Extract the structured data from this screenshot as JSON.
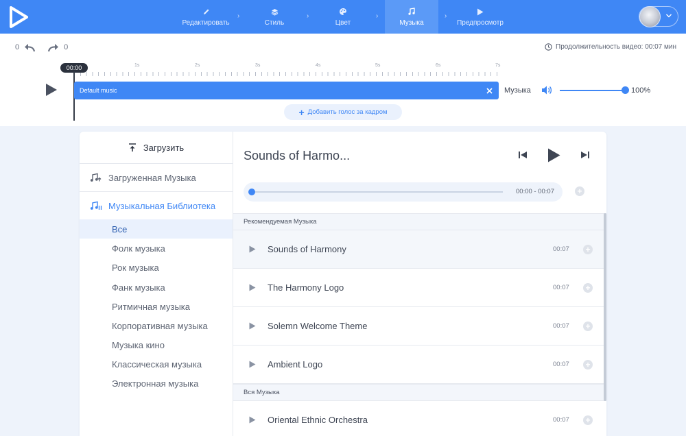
{
  "header": {
    "steps": [
      {
        "label": "Редактировать",
        "icon": "pencil-icon"
      },
      {
        "label": "Стиль",
        "icon": "layers-icon"
      },
      {
        "label": "Цвет",
        "icon": "palette-icon"
      },
      {
        "label": "Музыка",
        "icon": "music-note-icon",
        "active": true
      },
      {
        "label": "Предпросмотр",
        "icon": "play-icon"
      }
    ]
  },
  "history": {
    "undo_count": "0",
    "redo_count": "0"
  },
  "duration_text": "Продолжительность видео: 00:07 мин",
  "timeline": {
    "current_time": "00:00",
    "tick_labels": [
      "1s",
      "2s",
      "3s",
      "4s",
      "5s",
      "6s",
      "7s"
    ],
    "track_label": "Default music",
    "volume_label": "Музыка",
    "volume_percent": "100%",
    "volume_level": 1.0,
    "add_voice_label": "Добавить голос за кадром"
  },
  "sidebar": {
    "upload_label": "Загрузить",
    "uploaded_music": "Загруженная Музыка",
    "library": "Музыкальная Библиотека",
    "categories": [
      "Все",
      "Фолк музыка",
      "Рок музыка",
      "Фанк музыка",
      "Ритмичная музыка",
      "Корпоративная музыка",
      "Музыка кино",
      "Классическая музыка",
      "Электронная музыка"
    ],
    "active_category": "Все"
  },
  "player": {
    "title": "Sounds of Harmo...",
    "time": "00:00 - 00:07",
    "progress": 0
  },
  "lists": {
    "recommended_header": "Рекомендуемая Музыка",
    "all_header": "Вся Музыка",
    "recommended": [
      {
        "name": "Sounds of Harmony",
        "duration": "00:07"
      },
      {
        "name": "The Harmony Logo",
        "duration": "00:07"
      },
      {
        "name": "Solemn Welcome Theme",
        "duration": "00:07"
      },
      {
        "name": "Ambient Logo",
        "duration": "00:07"
      }
    ],
    "all": [
      {
        "name": "Oriental Ethnic Orchestra",
        "duration": "00:07"
      }
    ]
  },
  "colors": {
    "accent": "#3f87f5",
    "topbar": "#3f87f5",
    "background": "#eef3fb"
  }
}
